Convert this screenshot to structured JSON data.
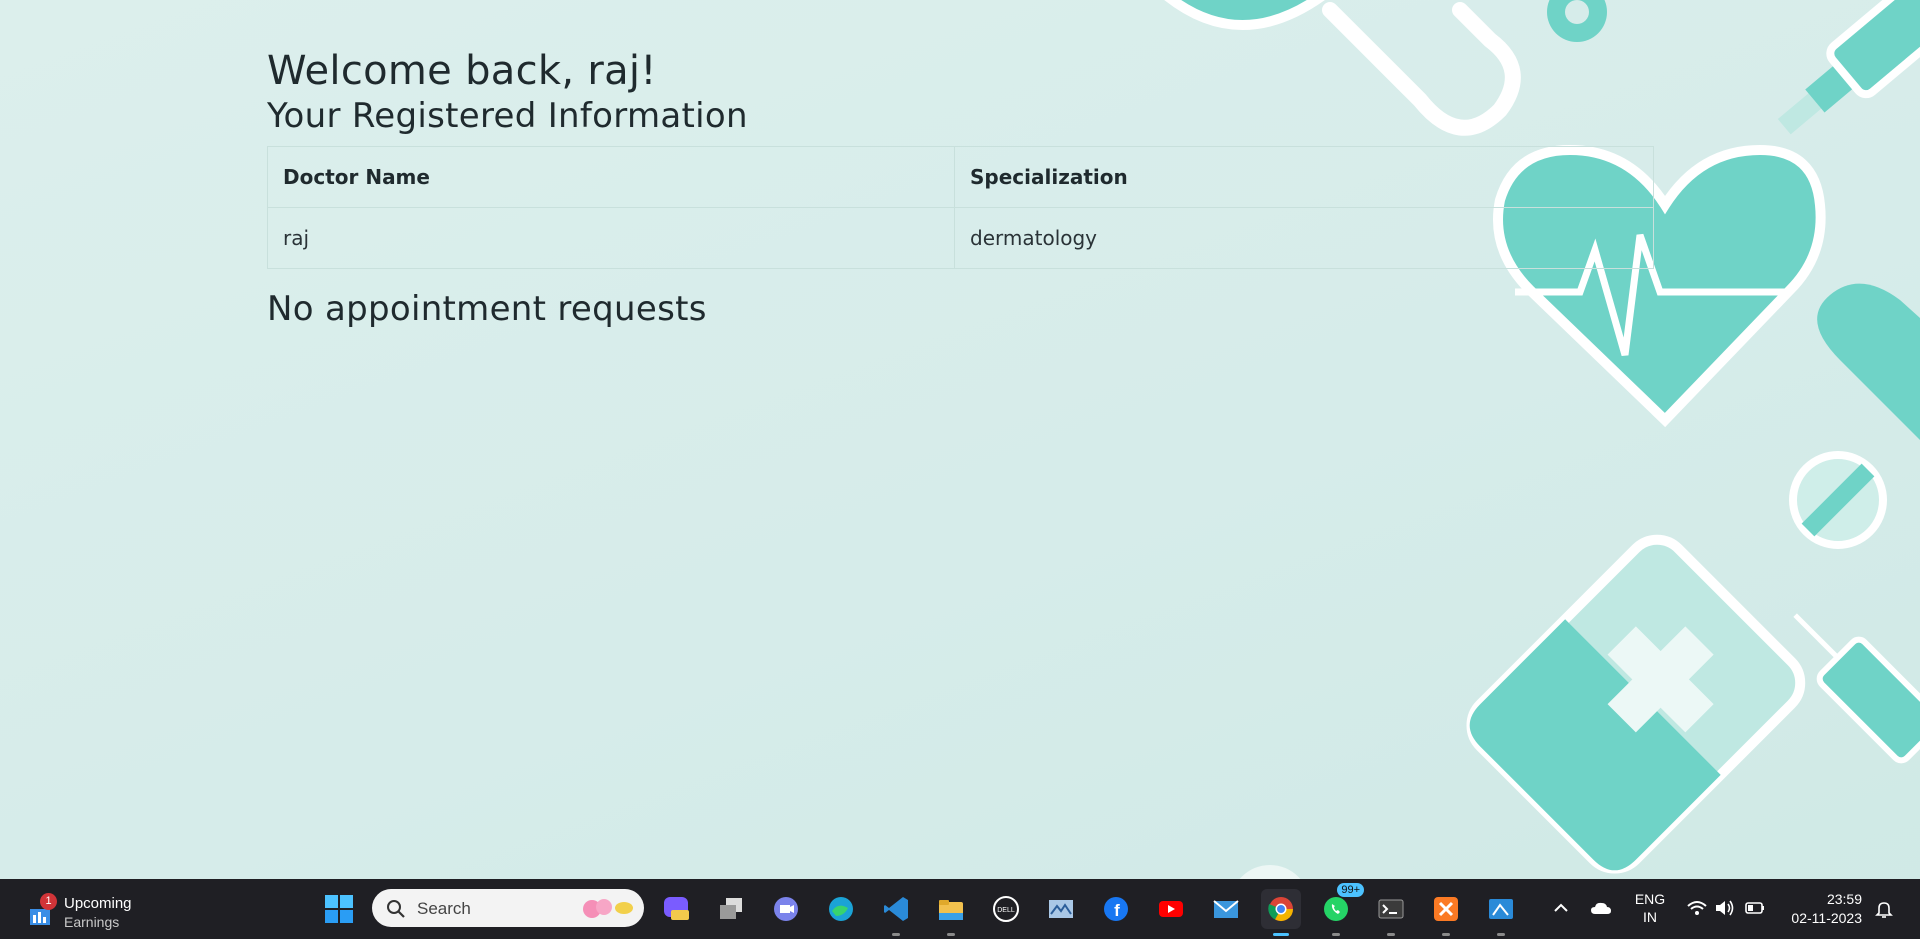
{
  "welcome_text": "Welcome back, raj!",
  "registered_heading": "Your Registered Information",
  "table": {
    "headers": [
      "Doctor Name",
      "Specialization"
    ],
    "rows": [
      [
        "raj",
        "dermatology"
      ]
    ]
  },
  "no_requests_text": "No appointment requests",
  "colors": {
    "accent_teal": "#6fd3c7",
    "background": "#d6ecea",
    "taskbar": "#1f1f24"
  },
  "taskbar": {
    "weather": {
      "title": "Upcoming",
      "subtitle": "Earnings",
      "badge": "1"
    },
    "search": {
      "placeholder": "Search"
    },
    "whatsapp_badge": "99+",
    "language": {
      "line1": "ENG",
      "line2": "IN"
    },
    "clock": {
      "time": "23:59",
      "date": "02-11-2023"
    },
    "apps": [
      "start-icon",
      "copilot-icon",
      "task-view-icon",
      "teams-icon",
      "edge-icon",
      "vscode-icon",
      "file-explorer-icon",
      "dell-icon",
      "photos-icon",
      "facebook-icon",
      "youtube-icon",
      "mail-icon",
      "chrome-icon",
      "whatsapp-icon",
      "terminal-icon",
      "xampp-icon",
      "paint-icon"
    ]
  }
}
